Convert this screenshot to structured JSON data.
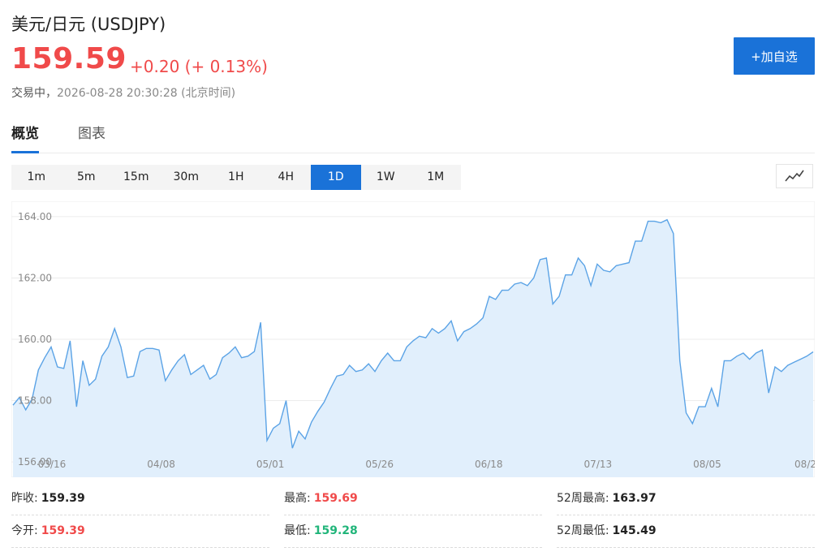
{
  "header": {
    "title": "美元/日元 (USDJPY)",
    "price": "159.59",
    "change": "+0.20 (+ 0.13%)",
    "status_label": "交易中，",
    "timestamp": "2026-08-28 20:30:28 (北京时间)",
    "add_button": "+加自选"
  },
  "tabs": [
    {
      "label": "概览",
      "active": true
    },
    {
      "label": "图表",
      "active": false
    }
  ],
  "periods": [
    {
      "label": "1m"
    },
    {
      "label": "5m"
    },
    {
      "label": "15m"
    },
    {
      "label": "30m"
    },
    {
      "label": "1H"
    },
    {
      "label": "4H"
    },
    {
      "label": "1D",
      "selected": true
    },
    {
      "label": "1W"
    },
    {
      "label": "1M"
    }
  ],
  "chart_type_icon": "line-chart-icon",
  "colors": {
    "up": "#f04a4a",
    "down": "#21b57a",
    "accent": "#1a72d8",
    "line": "#5ba3e6",
    "area": "#e1effc"
  },
  "chart_data": {
    "type": "area",
    "y_ticks": [
      "164.00",
      "162.00",
      "160.00",
      "158.00",
      "156.00"
    ],
    "ylim": [
      155.5,
      164.5
    ],
    "x_labels": [
      "03/16",
      "04/08",
      "05/01",
      "05/26",
      "06/18",
      "07/13",
      "08/05",
      "08/2"
    ],
    "grid": true,
    "values": [
      157.85,
      158.1,
      157.7,
      158.05,
      159.0,
      159.4,
      159.75,
      159.1,
      159.05,
      159.95,
      157.8,
      159.3,
      158.5,
      158.7,
      159.45,
      159.75,
      160.35,
      159.75,
      158.75,
      158.8,
      159.6,
      159.7,
      159.7,
      159.65,
      158.65,
      159.0,
      159.3,
      159.5,
      158.85,
      159.0,
      159.15,
      158.7,
      158.85,
      159.4,
      159.55,
      159.75,
      159.4,
      159.45,
      159.6,
      160.55,
      156.7,
      157.1,
      157.25,
      158.0,
      156.45,
      157.0,
      156.75,
      157.3,
      157.65,
      157.95,
      158.4,
      158.8,
      158.85,
      159.15,
      158.95,
      159.0,
      159.2,
      158.95,
      159.3,
      159.55,
      159.3,
      159.3,
      159.75,
      159.95,
      160.1,
      160.05,
      160.35,
      160.2,
      160.35,
      160.6,
      159.95,
      160.25,
      160.35,
      160.5,
      160.7,
      161.4,
      161.3,
      161.6,
      161.6,
      161.8,
      161.85,
      161.75,
      162.0,
      162.6,
      162.65,
      161.15,
      161.4,
      162.1,
      162.1,
      162.65,
      162.4,
      161.75,
      162.45,
      162.25,
      162.2,
      162.4,
      162.45,
      162.5,
      163.2,
      163.2,
      163.85,
      163.85,
      163.8,
      163.9,
      163.45,
      159.3,
      157.6,
      157.25,
      157.8,
      157.8,
      158.4,
      157.8,
      159.3,
      159.3,
      159.45,
      159.55,
      159.35,
      159.55,
      159.65,
      158.25,
      159.1,
      158.95,
      159.15,
      159.25,
      159.35,
      159.45,
      159.59
    ]
  },
  "stats": [
    {
      "label": "昨收:",
      "value": "159.39",
      "color": "black"
    },
    {
      "label": "最高:",
      "value": "159.69",
      "color": "red"
    },
    {
      "label": "52周最高:",
      "value": "163.97",
      "color": "black"
    },
    {
      "label": "今开:",
      "value": "159.39",
      "color": "red"
    },
    {
      "label": "最低:",
      "value": "159.28",
      "color": "green"
    },
    {
      "label": "52周最低:",
      "value": "145.49",
      "color": "black"
    }
  ]
}
